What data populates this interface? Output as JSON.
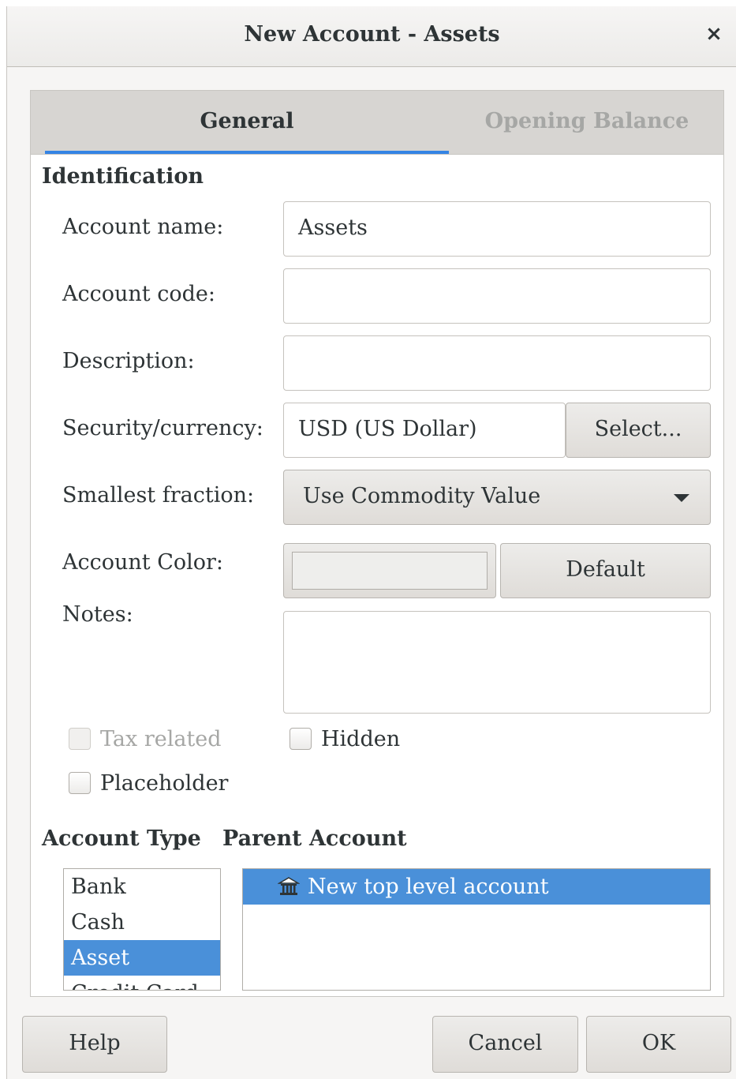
{
  "window": {
    "title": "New Account - Assets",
    "close_glyph": "×"
  },
  "tabs": [
    {
      "label": "General",
      "active": true
    },
    {
      "label": "Opening Balance",
      "active": false
    }
  ],
  "identification": {
    "heading": "Identification",
    "account_name_label": "Account name:",
    "account_name_value": "Assets",
    "account_code_label": "Account code:",
    "account_code_value": "",
    "description_label": "Description:",
    "description_value": "",
    "security_label": "Security/currency:",
    "security_value": "USD (US Dollar)",
    "select_button": "Select...",
    "fraction_label": "Smallest fraction:",
    "fraction_value": "Use Commodity Value",
    "color_label": "Account Color:",
    "color_value": "#eeeeec",
    "default_button": "Default",
    "notes_label": "Notes:",
    "notes_value": ""
  },
  "checkboxes": {
    "tax_related": {
      "label": "Tax related",
      "checked": false,
      "enabled": false
    },
    "hidden": {
      "label": "Hidden",
      "checked": false,
      "enabled": true
    },
    "placeholder": {
      "label": "Placeholder",
      "checked": false,
      "enabled": true
    }
  },
  "account_type": {
    "heading": "Account Type",
    "items": [
      "Bank",
      "Cash",
      "Asset",
      "Credit Card"
    ],
    "selected": "Asset"
  },
  "parent_account": {
    "heading": "Parent Account",
    "items": [
      {
        "label": "New top level account",
        "icon": "bank-icon",
        "selected": true
      }
    ]
  },
  "footer": {
    "help": "Help",
    "cancel": "Cancel",
    "ok": "OK"
  },
  "colors": {
    "accent": "#3584e4",
    "selection": "#4a90d9"
  }
}
